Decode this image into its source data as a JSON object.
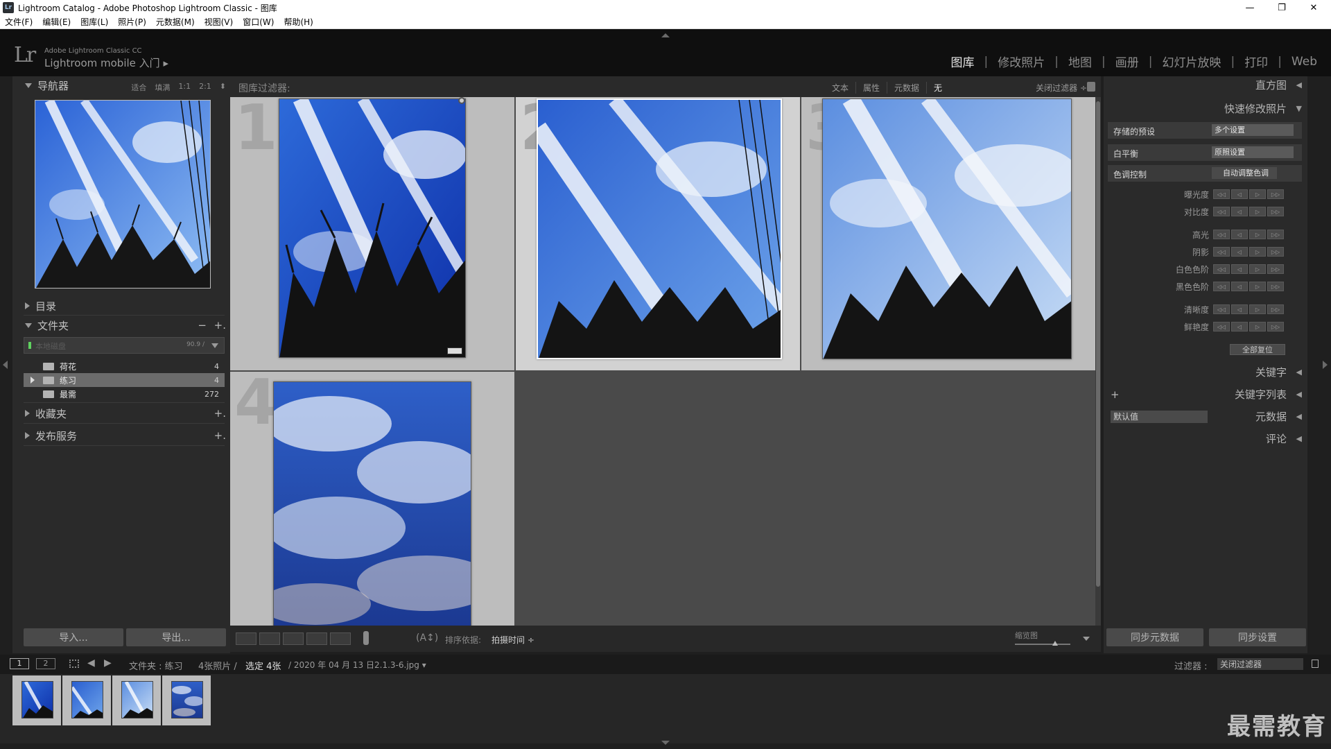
{
  "window": {
    "title": "Lightroom Catalog - Adobe Photoshop Lightroom Classic - 图库",
    "app_icon": "Lr",
    "min": "—",
    "max": "❐",
    "close": "✕"
  },
  "menu": [
    "文件(F)",
    "编辑(E)",
    "图库(L)",
    "照片(P)",
    "元数据(M)",
    "视图(V)",
    "窗口(W)",
    "帮助(H)"
  ],
  "identity": {
    "logo": "Lr",
    "product_line1": "Adobe Lightroom Classic CC",
    "product_line2": "Lightroom mobile 入门",
    "arrow": "▸"
  },
  "modules": [
    "图库",
    "修改照片",
    "地图",
    "画册",
    "幻灯片放映",
    "打印",
    "Web"
  ],
  "navigator": {
    "title": "导航器",
    "options": [
      "适合",
      "填满",
      "1:1",
      "2:1"
    ],
    "options_arrow": "⬍"
  },
  "left_sections": {
    "catalog": "目录",
    "folders": "文件夹",
    "collections": "收藏夹",
    "publish": "发布服务",
    "minus": "−",
    "plus": "+."
  },
  "volume": {
    "name": "本地磁盘",
    "size": "90.9 / "
  },
  "folders": [
    {
      "name": "荷花",
      "count": "4"
    },
    {
      "name": "练习",
      "count": "4"
    },
    {
      "name": "最需",
      "count": "272"
    }
  ],
  "buttons": {
    "import": "导入...",
    "export": "导出...",
    "sync_metadata": "同步元数据",
    "sync_settings": "同步设置"
  },
  "filter": {
    "title": "图库过滤器:",
    "tabs": [
      "文本",
      "属性",
      "元数据",
      "无"
    ],
    "close": "关闭过滤器 ÷"
  },
  "grid": {
    "cells": [
      "1",
      "2",
      "3",
      "4"
    ]
  },
  "toolbar": {
    "sort_label": "排序依据:",
    "sort_value": "拍摄时间 ÷",
    "thumb_label": "缩览图",
    "sort_icon": "(A↕)"
  },
  "right": {
    "histogram": "直方图",
    "quick_develop": "快速修改照片",
    "saved_preset_label": "存储的预设",
    "saved_preset_value": "多个设置",
    "wb_label": "白平衡",
    "wb_value": "原照设置",
    "tone_label": "色调控制",
    "auto_tone": "自动调整色调",
    "adjust": [
      "曝光度",
      "对比度",
      "高光",
      "阴影",
      "白色色阶",
      "黑色色阶",
      "清晰度",
      "鲜艳度"
    ],
    "adj_btns": [
      "◁◁",
      "◁",
      "▷",
      "▷▷"
    ],
    "reset_all": "全部复位",
    "keywording": "关键字",
    "keyword_list": "关键字列表",
    "keyword_plus": "+",
    "metadata_preset": "默认值",
    "metadata": "元数据",
    "comments": "评论"
  },
  "filmbar": {
    "page1": "1",
    "page2": "2",
    "source_prefix": "文件夹 : 练习",
    "count": "4张照片 /",
    "selected": "选定 4张",
    "file": "/ 2020 年 04 月 13 日2.1.3-6.jpg ▾",
    "filter_label": "过滤器 :",
    "filter_value": "关闭过滤器"
  },
  "watermark": "最需教育",
  "colors": {
    "sky_deep": "#1f4fc2",
    "sky_light": "#7fb0f0",
    "cloud": "#f2f5fb",
    "panel": "#2a2a2a",
    "grid_bg": "#4a4a4a",
    "cell": "#bdbdbd"
  }
}
